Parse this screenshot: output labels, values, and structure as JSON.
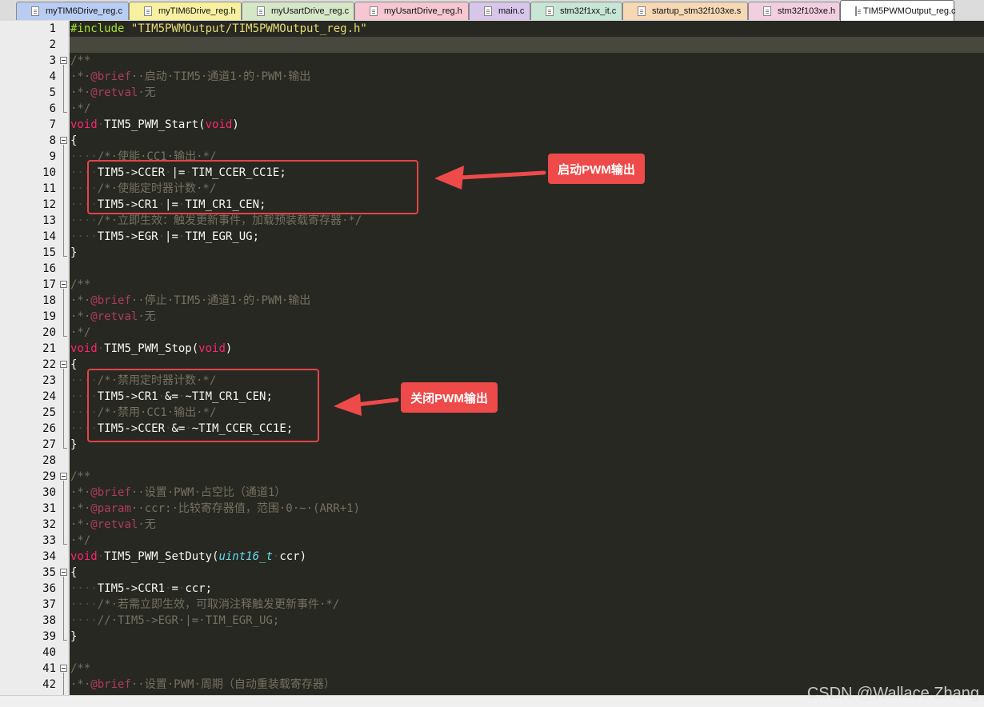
{
  "tabs": [
    {
      "label": "myTIM6Drive_reg.c",
      "color": "#b9cdf2",
      "active": false
    },
    {
      "label": "myTIM6Drive_reg.h",
      "color": "#f6f0a0",
      "active": false
    },
    {
      "label": "myUsartDrive_reg.c",
      "color": "#d5e7c6",
      "active": false
    },
    {
      "label": "myUsartDrive_reg.h",
      "color": "#f4c7d2",
      "active": false
    },
    {
      "label": "main.c",
      "color": "#d7c5ea",
      "active": false
    },
    {
      "label": "stm32f1xx_it.c",
      "color": "#c7e6d6",
      "active": false
    },
    {
      "label": "startup_stm32f103xe.s",
      "color": "#f6d8b4",
      "active": false
    },
    {
      "label": "stm32f103xe.h",
      "color": "#f2cfe0",
      "active": false
    },
    {
      "label": "TIM5PWMOutput_reg.c",
      "color": "#ffffff",
      "active": true
    }
  ],
  "code_lines": [
    {
      "n": 1,
      "tokens": [
        [
          "pp",
          "#include "
        ],
        [
          "str",
          "\"TIM5PWMOutput/TIM5PWMOutput_reg.h\""
        ]
      ]
    },
    {
      "n": 2,
      "tokens": []
    },
    {
      "n": 3,
      "fold": true,
      "tokens": [
        [
          "cm",
          "/**"
        ]
      ]
    },
    {
      "n": 4,
      "tokens": [
        [
          "cm",
          "·*·"
        ],
        [
          "tag",
          "@brief"
        ],
        [
          "cm",
          "··启动·TIM5·通道1·的·PWM·输出"
        ]
      ]
    },
    {
      "n": 5,
      "tokens": [
        [
          "cm",
          "·*·"
        ],
        [
          "tag",
          "@retval"
        ],
        [
          "cm",
          "·无"
        ]
      ]
    },
    {
      "n": 6,
      "tokens": [
        [
          "cm",
          "·*/"
        ]
      ]
    },
    {
      "n": 7,
      "tokens": [
        [
          "kw",
          "void"
        ],
        [
          "ws",
          "·"
        ],
        [
          "tx",
          "TIM5_PWM_Start("
        ],
        [
          "kw",
          "void"
        ],
        [
          "tx",
          ")"
        ]
      ]
    },
    {
      "n": 8,
      "fold": true,
      "tokens": [
        [
          "tx",
          "{"
        ]
      ]
    },
    {
      "n": 9,
      "tokens": [
        [
          "ws",
          "····"
        ],
        [
          "cm",
          "/*·使能·CC1·输出·*/"
        ]
      ]
    },
    {
      "n": 10,
      "tokens": [
        [
          "ws",
          "····"
        ],
        [
          "tx",
          "TIM5->CCER"
        ],
        [
          "ws",
          "·"
        ],
        [
          "tx",
          "|="
        ],
        [
          "ws",
          "·"
        ],
        [
          "tx",
          "TIM_CCER_CC1E;"
        ]
      ]
    },
    {
      "n": 11,
      "tokens": [
        [
          "ws",
          "····"
        ],
        [
          "cm",
          "/*·使能定时器计数·*/"
        ]
      ]
    },
    {
      "n": 12,
      "tokens": [
        [
          "ws",
          "····"
        ],
        [
          "tx",
          "TIM5->CR1"
        ],
        [
          "ws",
          "·"
        ],
        [
          "tx",
          "|="
        ],
        [
          "ws",
          "·"
        ],
        [
          "tx",
          "TIM_CR1_CEN;"
        ]
      ]
    },
    {
      "n": 13,
      "tokens": [
        [
          "ws",
          "····"
        ],
        [
          "cm",
          "/*·立即生效：触发更新事件，加载预装载寄存器·*/"
        ]
      ]
    },
    {
      "n": 14,
      "tokens": [
        [
          "ws",
          "····"
        ],
        [
          "tx",
          "TIM5->EGR"
        ],
        [
          "ws",
          "·"
        ],
        [
          "tx",
          "|="
        ],
        [
          "ws",
          "·"
        ],
        [
          "tx",
          "TIM_EGR_UG;"
        ]
      ]
    },
    {
      "n": 15,
      "tokens": [
        [
          "tx",
          "}"
        ]
      ]
    },
    {
      "n": 16,
      "tokens": []
    },
    {
      "n": 17,
      "fold": true,
      "tokens": [
        [
          "cm",
          "/**"
        ]
      ]
    },
    {
      "n": 18,
      "tokens": [
        [
          "cm",
          "·*·"
        ],
        [
          "tag",
          "@brief"
        ],
        [
          "cm",
          "··停止·TIM5·通道1·的·PWM·输出"
        ]
      ]
    },
    {
      "n": 19,
      "tokens": [
        [
          "cm",
          "·*·"
        ],
        [
          "tag",
          "@retval"
        ],
        [
          "cm",
          "·无"
        ]
      ]
    },
    {
      "n": 20,
      "tokens": [
        [
          "cm",
          "·*/"
        ]
      ]
    },
    {
      "n": 21,
      "tokens": [
        [
          "kw",
          "void"
        ],
        [
          "ws",
          "·"
        ],
        [
          "tx",
          "TIM5_PWM_Stop("
        ],
        [
          "kw",
          "void"
        ],
        [
          "tx",
          ")"
        ]
      ]
    },
    {
      "n": 22,
      "fold": true,
      "tokens": [
        [
          "tx",
          "{"
        ]
      ]
    },
    {
      "n": 23,
      "tokens": [
        [
          "ws",
          "····"
        ],
        [
          "cm",
          "/*·禁用定时器计数·*/"
        ]
      ]
    },
    {
      "n": 24,
      "tokens": [
        [
          "ws",
          "····"
        ],
        [
          "tx",
          "TIM5->CR1"
        ],
        [
          "ws",
          "·"
        ],
        [
          "tx",
          "&="
        ],
        [
          "ws",
          "·"
        ],
        [
          "tx",
          "~TIM_CR1_CEN;"
        ]
      ]
    },
    {
      "n": 25,
      "tokens": [
        [
          "ws",
          "····"
        ],
        [
          "cm",
          "/*·禁用·CC1·输出·*/"
        ]
      ]
    },
    {
      "n": 26,
      "tokens": [
        [
          "ws",
          "····"
        ],
        [
          "tx",
          "TIM5->CCER"
        ],
        [
          "ws",
          "·"
        ],
        [
          "tx",
          "&="
        ],
        [
          "ws",
          "·"
        ],
        [
          "tx",
          "~TIM_CCER_CC1E;"
        ]
      ]
    },
    {
      "n": 27,
      "tokens": [
        [
          "tx",
          "}"
        ]
      ]
    },
    {
      "n": 28,
      "tokens": []
    },
    {
      "n": 29,
      "fold": true,
      "tokens": [
        [
          "cm",
          "/**"
        ]
      ]
    },
    {
      "n": 30,
      "tokens": [
        [
          "cm",
          "·*·"
        ],
        [
          "tag",
          "@brief"
        ],
        [
          "cm",
          "··设置·PWM·占空比（通道1）"
        ]
      ]
    },
    {
      "n": 31,
      "tokens": [
        [
          "cm",
          "·*·"
        ],
        [
          "tag",
          "@param"
        ],
        [
          "cm",
          "··ccr:·比较寄存器值，范围·0·~·(ARR+1)"
        ]
      ]
    },
    {
      "n": 32,
      "tokens": [
        [
          "cm",
          "·*·"
        ],
        [
          "tag",
          "@retval"
        ],
        [
          "cm",
          "·无"
        ]
      ]
    },
    {
      "n": 33,
      "tokens": [
        [
          "cm",
          "·*/"
        ]
      ]
    },
    {
      "n": 34,
      "tokens": [
        [
          "kw",
          "void"
        ],
        [
          "ws",
          "·"
        ],
        [
          "tx",
          "TIM5_PWM_SetDuty("
        ],
        [
          "ty",
          "uint16_t"
        ],
        [
          "ws",
          "·"
        ],
        [
          "tx",
          "ccr)"
        ]
      ]
    },
    {
      "n": 35,
      "fold": true,
      "tokens": [
        [
          "tx",
          "{"
        ]
      ]
    },
    {
      "n": 36,
      "tokens": [
        [
          "ws",
          "····"
        ],
        [
          "tx",
          "TIM5->CCR1"
        ],
        [
          "ws",
          "·"
        ],
        [
          "tx",
          "="
        ],
        [
          "ws",
          "·"
        ],
        [
          "tx",
          "ccr;"
        ]
      ]
    },
    {
      "n": 37,
      "tokens": [
        [
          "ws",
          "····"
        ],
        [
          "cm",
          "/*·若需立即生效，可取消注释触发更新事件·*/"
        ]
      ]
    },
    {
      "n": 38,
      "tokens": [
        [
          "ws",
          "····"
        ],
        [
          "cm",
          "//·TIM5->EGR·|=·TIM_EGR_UG;"
        ]
      ]
    },
    {
      "n": 39,
      "tokens": [
        [
          "tx",
          "}"
        ]
      ]
    },
    {
      "n": 40,
      "tokens": []
    },
    {
      "n": 41,
      "fold": true,
      "tokens": [
        [
          "cm",
          "/**"
        ]
      ]
    },
    {
      "n": 42,
      "tokens": [
        [
          "cm",
          "·*·"
        ],
        [
          "tag",
          "@brief"
        ],
        [
          "cm",
          "··设置·PWM·周期（自动重装载寄存器）"
        ]
      ]
    }
  ],
  "annotations": {
    "start_label": "启动PWM输出",
    "stop_label": "关闭PWM输出"
  },
  "watermark": "CSDN @Wallace Zhang"
}
